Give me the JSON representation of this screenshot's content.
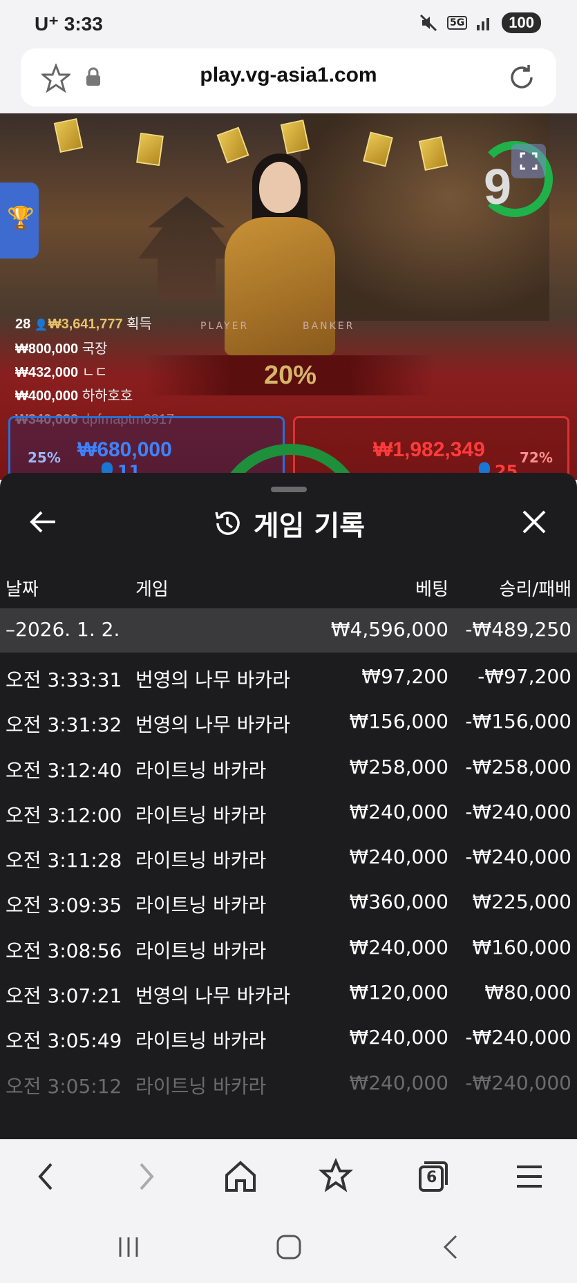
{
  "status_bar": {
    "carrier": "U⁺",
    "time": "3:33",
    "battery": "100",
    "network": "5G"
  },
  "browser": {
    "url": "play.vg-asia1.com",
    "tab_count": "6"
  },
  "game_stage": {
    "timer": "9",
    "winners_header": {
      "count": "28",
      "total": "₩3,641,777",
      "label": "획득"
    },
    "winners": [
      {
        "amount": "₩800,000",
        "name": "국장"
      },
      {
        "amount": "₩432,000",
        "name": "ㄴㄷ"
      },
      {
        "amount": "₩400,000",
        "name": "하하호호"
      },
      {
        "amount": "₩340,000",
        "name": "dpfmaptm0917"
      }
    ],
    "multiplier": "20%",
    "table_labels": {
      "player": "PLAYER",
      "banker": "BANKER"
    },
    "player": {
      "percent": "25%",
      "amount": "₩680,000",
      "count": "11"
    },
    "banker": {
      "percent": "72%",
      "amount": "₩1,982,349",
      "count": "25"
    }
  },
  "history": {
    "title": "게임 기록",
    "columns": {
      "date": "날짜",
      "game": "게임",
      "bet": "베팅",
      "result": "승리/패배"
    },
    "day": {
      "date": "–2026. 1. 2.",
      "bet": "₩4,596,000",
      "result": "-₩489,250"
    },
    "rows": [
      {
        "time": "오전 3:33:31",
        "game": "번영의 나무 바카라",
        "bet": "₩97,200",
        "result": "-₩97,200"
      },
      {
        "time": "오전 3:31:32",
        "game": "번영의 나무 바카라",
        "bet": "₩156,000",
        "result": "-₩156,000"
      },
      {
        "time": "오전 3:12:40",
        "game": "라이트닝 바카라",
        "bet": "₩258,000",
        "result": "-₩258,000"
      },
      {
        "time": "오전 3:12:00",
        "game": "라이트닝 바카라",
        "bet": "₩240,000",
        "result": "-₩240,000"
      },
      {
        "time": "오전 3:11:28",
        "game": "라이트닝 바카라",
        "bet": "₩240,000",
        "result": "-₩240,000"
      },
      {
        "time": "오전 3:09:35",
        "game": "라이트닝 바카라",
        "bet": "₩360,000",
        "result": "₩225,000"
      },
      {
        "time": "오전 3:08:56",
        "game": "라이트닝 바카라",
        "bet": "₩240,000",
        "result": "₩160,000"
      },
      {
        "time": "오전 3:07:21",
        "game": "번영의 나무 바카라",
        "bet": "₩120,000",
        "result": "₩80,000"
      },
      {
        "time": "오전 3:05:49",
        "game": "라이트닝 바카라",
        "bet": "₩240,000",
        "result": "-₩240,000"
      },
      {
        "time": "오전 3:05:12",
        "game": "라이트닝 바카라",
        "bet": "₩240,000",
        "result": "-₩240,000"
      }
    ]
  },
  "colors": {
    "sheet_bg": "#1c1c1e",
    "day_row_bg": "#3a3a3c",
    "player_blue": "#3e82ff",
    "banker_red": "#ff3b3b",
    "timer_green": "#1fb24a"
  }
}
